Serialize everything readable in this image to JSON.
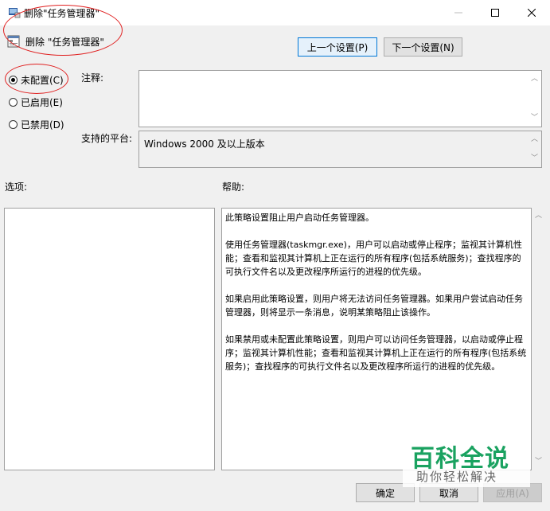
{
  "window": {
    "title": "删除\"任务管理器\"",
    "minimize_glyph": "—",
    "maximize_glyph": "☐",
    "close_glyph": "✕"
  },
  "header": {
    "policy_name": "删除 \"任务管理器\"",
    "prev_label": "上一个设置(P)",
    "next_label": "下一个设置(N)"
  },
  "state": {
    "options": [
      {
        "label": "未配置(C)",
        "checked": true
      },
      {
        "label": "已启用(E)",
        "checked": false
      },
      {
        "label": "已禁用(D)",
        "checked": false
      }
    ]
  },
  "fields": {
    "comment_label": "注释:",
    "comment_value": "",
    "platform_label": "支持的平台:",
    "platform_value": "Windows 2000 及以上版本"
  },
  "sections": {
    "options_label": "选项:",
    "help_label": "帮助:"
  },
  "help": {
    "text": "此策略设置阻止用户启动任务管理器。\n\n使用任务管理器(taskmgr.exe)，用户可以启动或停止程序；监视其计算机性能；查看和监视其计算机上正在运行的所有程序(包括系统服务)；查找程序的可执行文件名以及更改程序所运行的进程的优先级。\n\n如果启用此策略设置，则用户将无法访问任务管理器。如果用户尝试启动任务管理器，则将显示一条消息，说明某策略阻止该操作。\n\n如果禁用或未配置此策略设置，则用户可以访问任务管理器，以启动或停止程序；监视其计算机性能；查看和监视其计算机上正在运行的所有程序(包括系统服务)；查找程序的可执行文件名以及更改程序所运行的进程的优先级。"
  },
  "footer": {
    "ok_label": "确定",
    "cancel_label": "取消",
    "apply_label": "应用(A)"
  },
  "watermark": {
    "main": "百科全说",
    "sub": "助你轻松解决"
  },
  "colors": {
    "annotation": "#e02020",
    "accent": "#0078d7",
    "watermark_green": "#1aa260"
  },
  "icons": {
    "app": "policy-editor-icon",
    "policy": "policy-setting-icon",
    "scroll_up": "chevron-up-icon",
    "scroll_down": "chevron-down-icon"
  }
}
